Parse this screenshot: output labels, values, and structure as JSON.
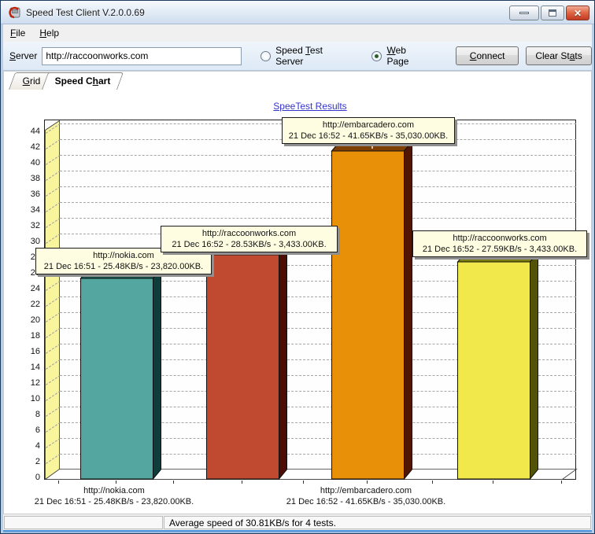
{
  "window": {
    "title": "Speed Test Client V.2.0.0.69"
  },
  "menu": {
    "file": {
      "text": "File",
      "u": 0
    },
    "help": {
      "text": "Help",
      "u": 0
    }
  },
  "toolbar": {
    "server_label": {
      "text": "Server",
      "u": 0
    },
    "server_value": "http://raccoonworks.com",
    "radio_speed_test": {
      "text": "Speed Test Server",
      "u": 6
    },
    "radio_web_page": {
      "text": "Web Page",
      "u": 0
    },
    "connect_label": {
      "text": "Connect",
      "u": 0
    },
    "clear_stats_label": {
      "text": "Clear Stats",
      "u": 8
    }
  },
  "tabs": {
    "grid": {
      "text": "Grid",
      "u": 0
    },
    "speed_chart": {
      "text": "Speed Chart",
      "u": 7
    }
  },
  "chart_data": {
    "type": "bar",
    "title": "SpeeTest Results",
    "xlabel": "",
    "ylabel": "",
    "ylim": [
      0,
      44
    ],
    "ytick_step": 2,
    "grid": "horizontal-dashed",
    "wall_color": "#F9F59C",
    "bars": [
      {
        "site": "http://nokia.com",
        "detail": "21 Dec 16:51 - 25.48KB/s - 23,820.00KB.",
        "value": 25.48,
        "front": "#54A7A0",
        "top": "#175653",
        "side": "#0D3E3B",
        "show_axis_label": true
      },
      {
        "site": "http://raccoonworks.com",
        "detail": "21 Dec 16:52 - 28.53KB/s - 3,433.00KB.",
        "value": 28.53,
        "front": "#C04A2F",
        "top": "#7C1A0A",
        "side": "#4E0D04",
        "show_axis_label": false
      },
      {
        "site": "http://embarcadero.com",
        "detail": "21 Dec 16:52 - 41.65KB/s - 35,030.00KB.",
        "value": 41.65,
        "front": "#E89008",
        "top": "#7E3F04",
        "side": "#511503",
        "show_axis_label": true
      },
      {
        "site": "http://raccoonworks.com",
        "detail": "21 Dec 16:52 - 27.59KB/s - 3,433.00KB.",
        "value": 27.59,
        "front": "#F1E84B",
        "top": "#7D7D10",
        "side": "#525208",
        "show_axis_label": false
      }
    ]
  },
  "statusbar": {
    "average_text": "Average speed of 30.81KB/s for 4 tests."
  }
}
